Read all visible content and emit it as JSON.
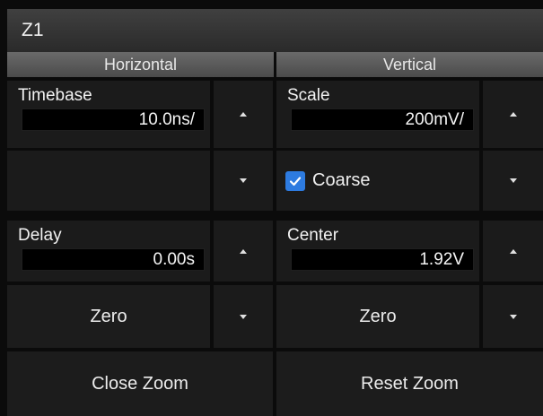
{
  "window": {
    "title": "Z1"
  },
  "columns": {
    "horizontal": "Horizontal",
    "vertical": "Vertical"
  },
  "horizontal": {
    "timebase": {
      "label": "Timebase",
      "value": "10.0ns/"
    },
    "delay": {
      "label": "Delay",
      "value": "0.00s"
    },
    "zero_label": "Zero"
  },
  "vertical": {
    "scale": {
      "label": "Scale",
      "value": "200mV/"
    },
    "coarse": {
      "label": "Coarse",
      "checked": true
    },
    "center": {
      "label": "Center",
      "value": "1.92V"
    },
    "zero_label": "Zero"
  },
  "actions": {
    "close_zoom": "Close Zoom",
    "reset_zoom": "Reset Zoom"
  },
  "colors": {
    "accent": "#2d7be0",
    "background": "#0b0b0b",
    "header": "#5a5a5a"
  }
}
